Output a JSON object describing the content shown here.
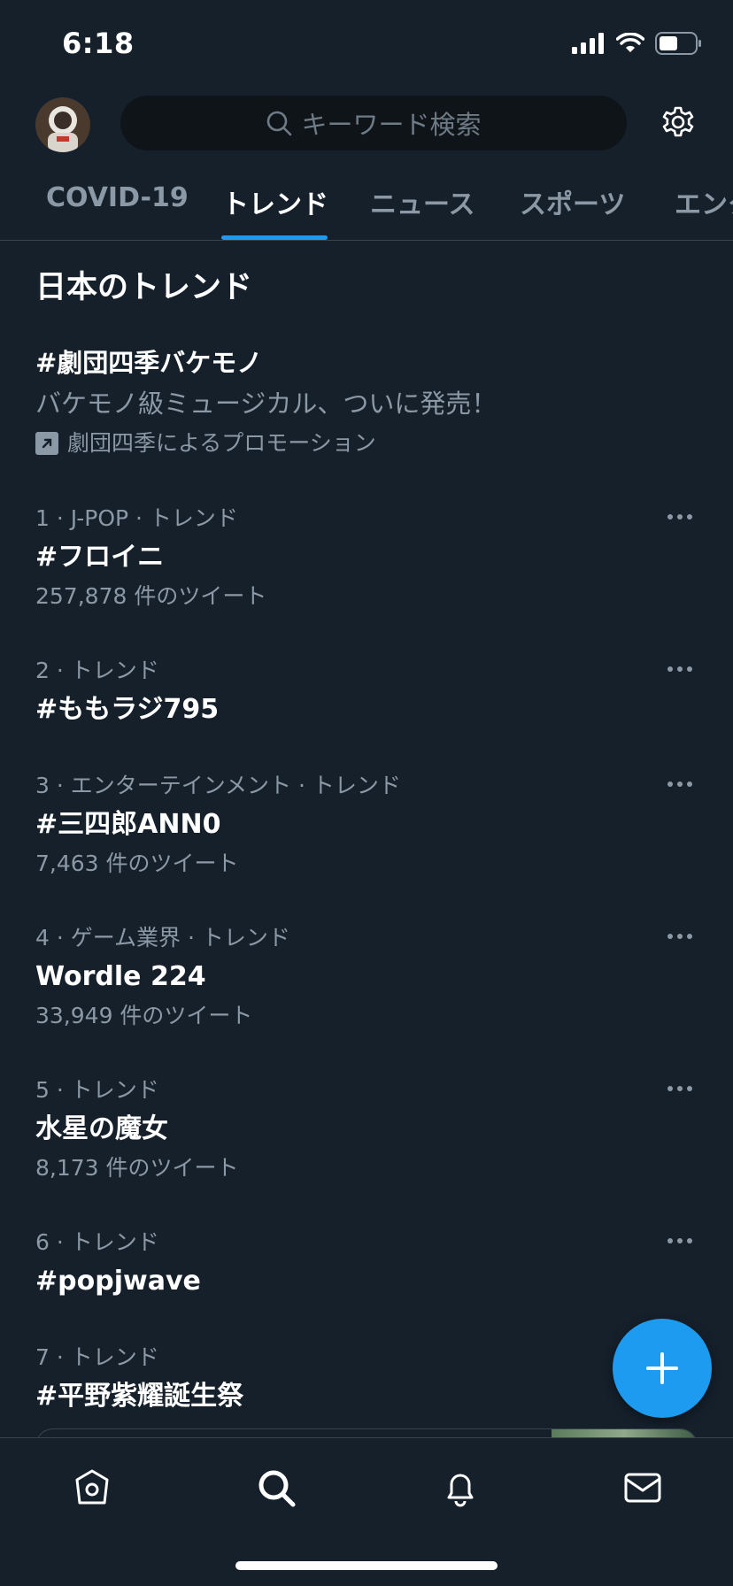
{
  "status_bar": {
    "time": "6:18"
  },
  "header": {
    "search_placeholder": "キーワード検索"
  },
  "tabs": [
    {
      "label": "COVID-19",
      "active": false
    },
    {
      "label": "トレンド",
      "active": true
    },
    {
      "label": "ニュース",
      "active": false
    },
    {
      "label": "スポーツ",
      "active": false
    },
    {
      "label": "エンタ",
      "active": false
    }
  ],
  "section_title": "日本のトレンド",
  "promoted": {
    "title": "#劇団四季バケモノ",
    "description": "バケモノ級ミュージカル、ついに発売！",
    "promoted_by": "劇団四季によるプロモーション"
  },
  "trends": [
    {
      "meta": "1 · J-POP · トレンド",
      "name": "#フロイニ",
      "count": "257,878 件のツイート"
    },
    {
      "meta": "2 · トレンド",
      "name": "#ももラジ795",
      "count": ""
    },
    {
      "meta": "3 · エンターテインメント · トレンド",
      "name": "#三四郎ANN0",
      "count": "7,463 件のツイート"
    },
    {
      "meta": "4 · ゲーム業界 · トレンド",
      "name": "Wordle 224",
      "count": "33,949 件のツイート"
    },
    {
      "meta": "5 · トレンド",
      "name": "水星の魔女",
      "count": "8,173 件のツイート"
    },
    {
      "meta": "6 · トレンド",
      "name": "#popjwave",
      "count": ""
    },
    {
      "meta": "7 · トレンド",
      "name": "#平野紫耀誕生祭",
      "count": ""
    }
  ],
  "colors": {
    "background": "#15202b",
    "accent": "#1d9bf0",
    "secondary_text": "#8b98a5"
  },
  "icons": {
    "status": [
      "signal-icon",
      "wifi-icon",
      "battery-icon"
    ],
    "tabbar": [
      "home-icon",
      "search-icon",
      "bell-icon",
      "mail-icon"
    ],
    "fab": "plus-icon",
    "settings": "gear-icon"
  }
}
